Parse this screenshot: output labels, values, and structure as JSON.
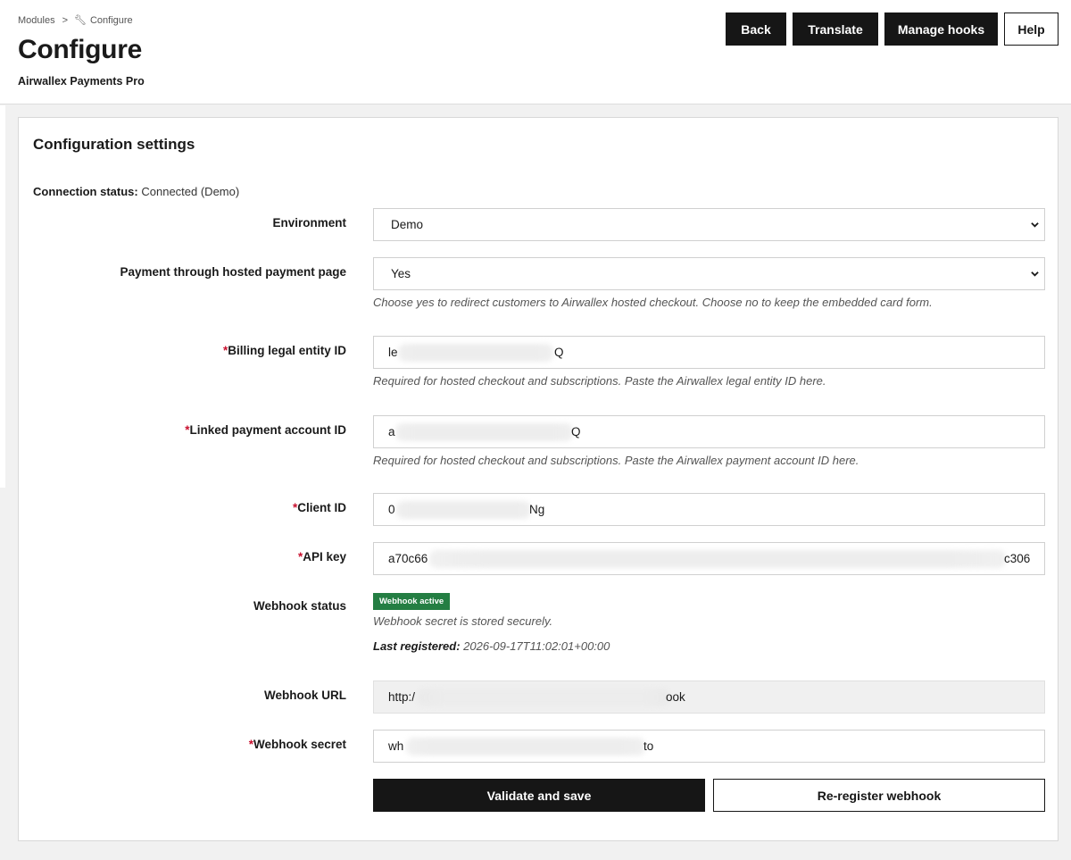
{
  "breadcrumb": {
    "modules": "Modules",
    "separator": ">",
    "current": "Configure"
  },
  "page": {
    "title": "Configure",
    "subtitle": "Airwallex Payments Pro"
  },
  "toolbar": {
    "back": "Back",
    "translate": "Translate",
    "manage_hooks": "Manage hooks",
    "help": "Help"
  },
  "panel": {
    "title": "Configuration settings",
    "connection_label": "Connection status:",
    "connection_value": "Connected (Demo)"
  },
  "form": {
    "environment": {
      "label": "Environment",
      "value": "Demo"
    },
    "hosted_page": {
      "label": "Payment through hosted payment page",
      "value": "Yes",
      "help": "Choose yes to redirect customers to Airwallex hosted checkout. Choose no to keep the embedded card form."
    },
    "billing_entity": {
      "required_mark": "*",
      "label": "Billing legal entity ID",
      "value_start": "le",
      "value_end": "Q",
      "help": "Required for hosted checkout and subscriptions. Paste the Airwallex legal entity ID here."
    },
    "linked_account": {
      "required_mark": "*",
      "label": "Linked payment account ID",
      "value_start": "a",
      "value_end": "Q",
      "help": "Required for hosted checkout and subscriptions. Paste the Airwallex payment account ID here."
    },
    "client_id": {
      "required_mark": "*",
      "label": "Client ID",
      "value_start": "0",
      "value_end": "Ng"
    },
    "api_key": {
      "required_mark": "*",
      "label": "API key",
      "value_start": "a70c66",
      "value_end": "c306"
    },
    "webhook_status": {
      "label": "Webhook status",
      "badge": "Webhook active",
      "note": "Webhook secret is stored securely.",
      "last_registered_label": "Last registered:",
      "last_registered_value": "2026-09-17T11:02:01+00:00",
      "badge_color": "#247e43"
    },
    "webhook_url": {
      "label": "Webhook URL",
      "value_start": "http:/",
      "value_end": "ook"
    },
    "webhook_secret": {
      "required_mark": "*",
      "label": "Webhook secret",
      "value_start": "wh",
      "value_end": "to"
    }
  },
  "actions": {
    "validate": "Validate and save",
    "reregister": "Re-register webhook"
  },
  "colors": {
    "required": "#c8102e",
    "primary": "#161616"
  },
  "icons": {
    "breadcrumb": "wrench-icon",
    "select": "chevron-down-icon"
  }
}
